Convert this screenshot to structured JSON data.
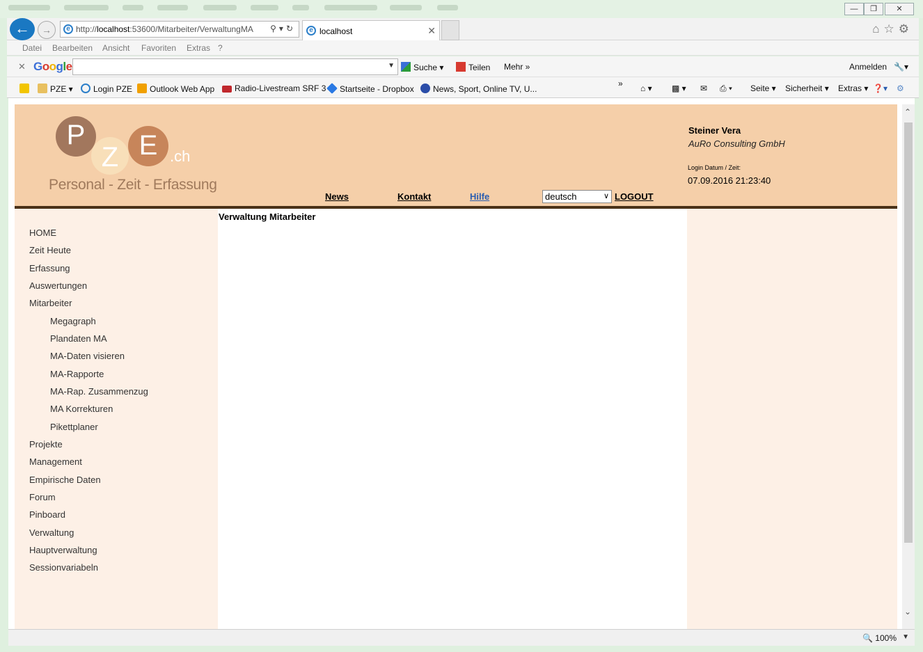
{
  "browser": {
    "address": {
      "prefix": "http://",
      "host": "localhost",
      "path": ":53600/Mitarbeiter/VerwaltungMA"
    },
    "tab_title": "localhost",
    "menu": [
      "Datei",
      "Bearbeiten",
      "Ansicht",
      "Favoriten",
      "Extras",
      "?"
    ],
    "google_toolbar": {
      "logo": [
        "G",
        "o",
        "o",
        "g",
        "l",
        "e"
      ],
      "search_label": "Suche",
      "share_label": "Teilen",
      "more_label": "Mehr »",
      "signin_label": "Anmelden"
    },
    "favorites": [
      {
        "label": "PZE ▾",
        "icon": "folder-icon"
      },
      {
        "label": "Login PZE",
        "icon": "ie-page-icon"
      },
      {
        "label": "Outlook Web App",
        "icon": "outlook-icon"
      },
      {
        "label": "Radio-Livestream SRF 3",
        "icon": "srf-icon"
      },
      {
        "label": "Startseite - Dropbox",
        "icon": "dropbox-icon"
      },
      {
        "label": "News, Sport, Online TV, U...",
        "icon": "news-icon"
      }
    ],
    "commands": {
      "page": "Seite ▾",
      "security": "Sicherheit ▾",
      "tools": "Extras ▾"
    },
    "zoom": "100%"
  },
  "page": {
    "logo": {
      "p": "P",
      "z": "Z",
      "e": "E",
      "ch": ".ch",
      "subtitle": "Personal - Zeit - Erfassung"
    },
    "topnav": {
      "news": "News",
      "contact": "Kontakt",
      "help": "Hilfe",
      "language": "deutsch",
      "logout": "LOGOUT"
    },
    "user": {
      "name": "Steiner Vera",
      "company": "AuRo Consulting GmbH",
      "login_label": "Login Datum / Zeit:",
      "login_time": "07.09.2016 21:23:40"
    },
    "title": "Verwaltung Mitarbeiter",
    "sidebar": {
      "items": [
        "HOME",
        "Zeit Heute",
        "Erfassung",
        "Auswertungen",
        "Mitarbeiter",
        "Megagraph",
        "Plandaten MA",
        "MA-Daten visieren",
        "MA-Rapporte",
        "MA-Rap. Zusammenzug",
        "MA Korrekturen",
        "Pikettplaner",
        "Projekte",
        "Management",
        "Empirische Daten",
        "Forum",
        "Pinboard",
        "Verwaltung",
        "Hauptverwaltung",
        "Sessionvariabeln"
      ]
    }
  },
  "colors": {
    "header_bg": "#f5cfa9",
    "sidebar_bg": "#fdf0e6",
    "rule": "#4a3218",
    "ie_blue": "#1a78c2"
  }
}
